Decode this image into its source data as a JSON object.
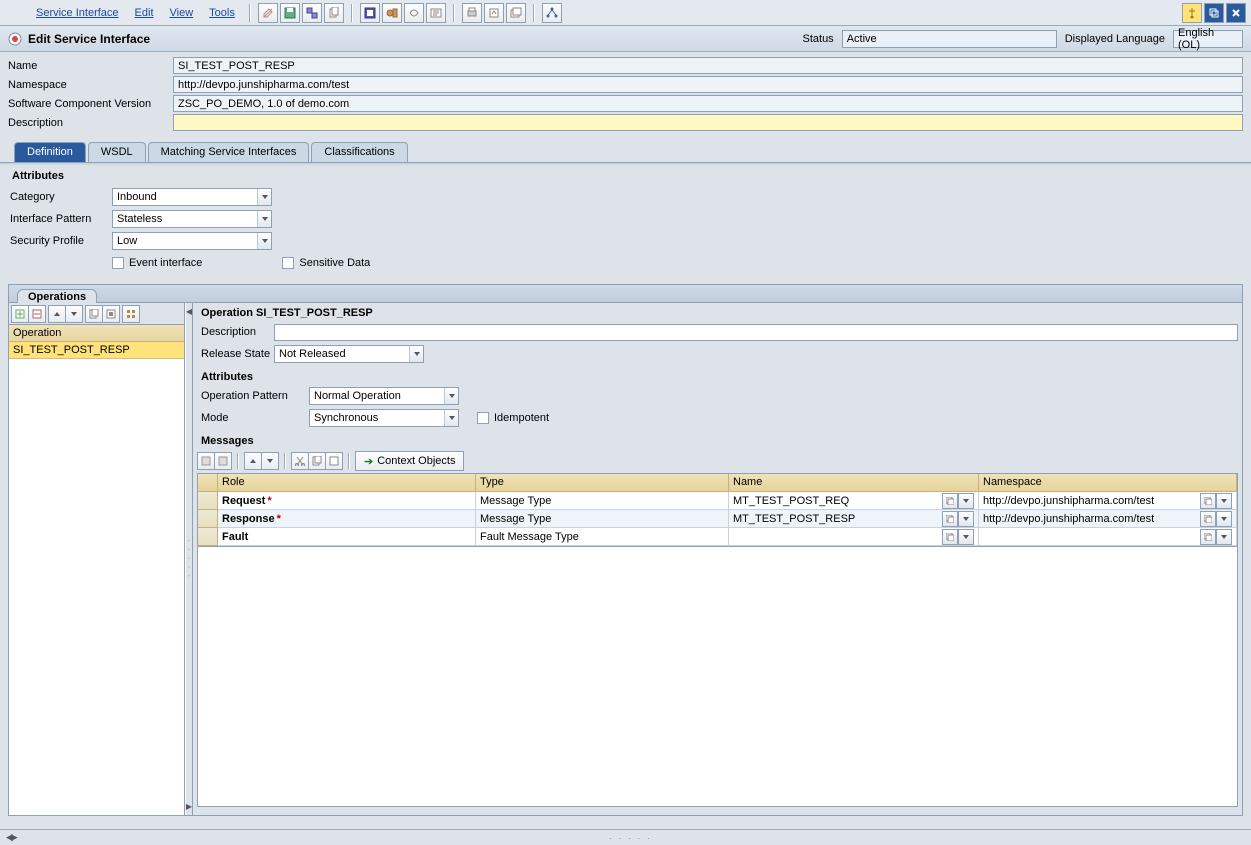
{
  "menu": {
    "m1": "Service Interface",
    "m2": "Edit",
    "m3": "View",
    "m4": "Tools"
  },
  "header": {
    "title": "Edit Service Interface",
    "status_label": "Status",
    "status_value": "Active",
    "lang_label": "Displayed Language",
    "lang_value": "English (OL)"
  },
  "form": {
    "name_label": "Name",
    "name": "SI_TEST_POST_RESP",
    "ns_label": "Namespace",
    "ns": "http://devpo.junshipharma.com/test",
    "scv_label": "Software Component Version",
    "scv": "ZSC_PO_DEMO, 1.0 of demo.com",
    "desc_label": "Description",
    "desc": ""
  },
  "tabs": {
    "t1": "Definition",
    "t2": "WSDL",
    "t3": "Matching Service Interfaces",
    "t4": "Classifications"
  },
  "attributes": {
    "section": "Attributes",
    "cat_label": "Category",
    "cat": "Inbound",
    "ip_label": "Interface Pattern",
    "ip": "Stateless",
    "sp_label": "Security Profile",
    "sp": "Low",
    "event": "Event interface",
    "sensitive": "Sensitive Data"
  },
  "operations": {
    "section": "Operations",
    "col": "Operation",
    "row0": "SI_TEST_POST_RESP"
  },
  "right": {
    "title": "Operation SI_TEST_POST_RESP",
    "desc_label": "Description",
    "desc": "",
    "rs_label": "Release State",
    "rs": "Not Released",
    "attr_section": "Attributes",
    "opat_label": "Operation Pattern",
    "opat": "Normal Operation",
    "mode_label": "Mode",
    "mode": "Synchronous",
    "idem": "Idempotent",
    "msg_section": "Messages",
    "ctx_btn": "Context Objects"
  },
  "grid": {
    "h_role": "Role",
    "h_type": "Type",
    "h_name": "Name",
    "h_ns": "Namespace",
    "rows": [
      {
        "role": "Request",
        "req": true,
        "type": "Message Type",
        "name": "MT_TEST_POST_REQ",
        "ns": "http://devpo.junshipharma.com/test"
      },
      {
        "role": "Response",
        "req": true,
        "type": "Message Type",
        "name": "MT_TEST_POST_RESP",
        "ns": "http://devpo.junshipharma.com/test"
      },
      {
        "role": "Fault",
        "req": false,
        "type": "Fault Message Type",
        "name": "",
        "ns": ""
      }
    ]
  }
}
